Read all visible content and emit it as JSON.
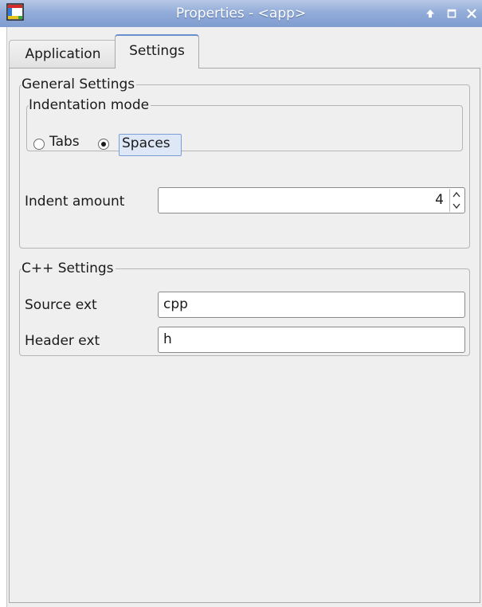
{
  "window": {
    "title": "Properties - <app>"
  },
  "tabs": [
    {
      "label": "Application"
    },
    {
      "label": "Settings"
    }
  ],
  "active_tab": "Settings",
  "general_settings": {
    "legend": "General Settings",
    "indentation": {
      "legend": "Indentation mode",
      "options": [
        {
          "label": "Tabs",
          "selected": false
        },
        {
          "label": "Spaces",
          "selected": true
        }
      ]
    },
    "indent_amount": {
      "label": "Indent amount",
      "value": "4"
    }
  },
  "cpp_settings": {
    "legend": "C++ Settings",
    "source_ext": {
      "label": "Source ext",
      "value": "cpp"
    },
    "header_ext": {
      "label": "Header ext",
      "value": "h"
    }
  },
  "colors": {
    "titlebar": "#8fa9d6",
    "title_text": "#ffffff",
    "panel_bg": "#efefef",
    "focus_highlight": "#dde7f6",
    "tab_accent": "#6a8fcf"
  },
  "icons": [
    "app-icon",
    "shade-icon",
    "maximize-icon",
    "close-icon",
    "spin-up-icon",
    "spin-down-icon"
  ]
}
